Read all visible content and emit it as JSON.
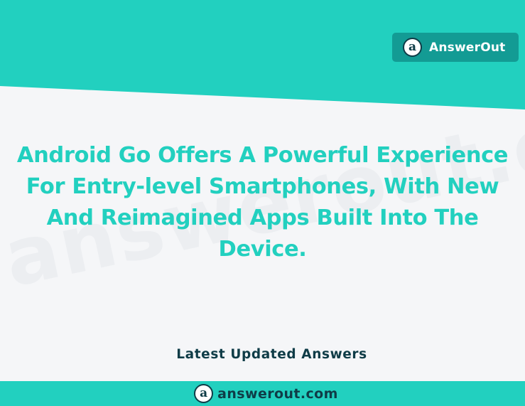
{
  "brand": {
    "name": "AnswerOut",
    "logo_letter": "a",
    "color": "#139b94"
  },
  "headline": {
    "text": "Android Go Offers A Powerful Experience For Entry-level Smartphones, With New And Reimagined Apps Built Into The Device.",
    "color": "#22d0bf"
  },
  "watermark": {
    "text": "answerout.com"
  },
  "section": {
    "latest_label": "Latest Updated Answers"
  },
  "footer": {
    "logo_letter": "a",
    "domain": "answerout.com",
    "color": "#22d0bf"
  },
  "theme": {
    "accent": "#22d0bf",
    "dark": "#0f3c47",
    "background": "#f5f6f8"
  }
}
